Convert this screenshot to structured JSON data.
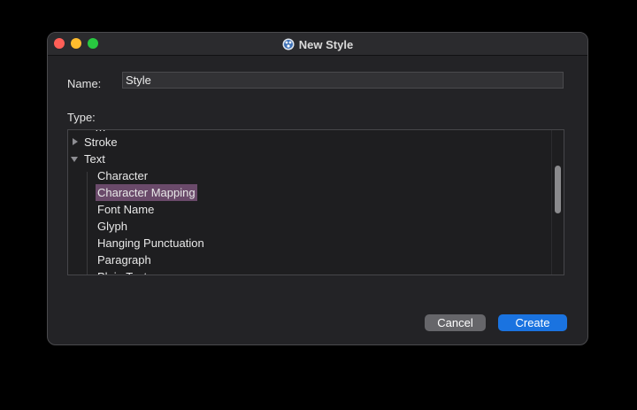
{
  "window": {
    "title": "New Style",
    "app_icon": "app-icon"
  },
  "form": {
    "name_label": "Name:",
    "name_value": "Style",
    "type_label": "Type:"
  },
  "tree": {
    "partial_top": "…",
    "items": [
      {
        "label": "Stroke",
        "expanded": false,
        "level": 0
      },
      {
        "label": "Text",
        "expanded": true,
        "level": 0
      },
      {
        "label": "Character",
        "level": 1
      },
      {
        "label": "Character Mapping",
        "level": 1,
        "selected": true
      },
      {
        "label": "Font Name",
        "level": 1
      },
      {
        "label": "Glyph",
        "level": 1
      },
      {
        "label": "Hanging Punctuation",
        "level": 1
      },
      {
        "label": "Paragraph",
        "level": 1
      },
      {
        "label": "Plain Text",
        "level": 1,
        "partial": true
      }
    ]
  },
  "buttons": {
    "cancel": "Cancel",
    "create": "Create"
  },
  "colors": {
    "selection": "#6a4a6a",
    "primary_button": "#1a73e0",
    "secondary_button": "#66666a"
  }
}
